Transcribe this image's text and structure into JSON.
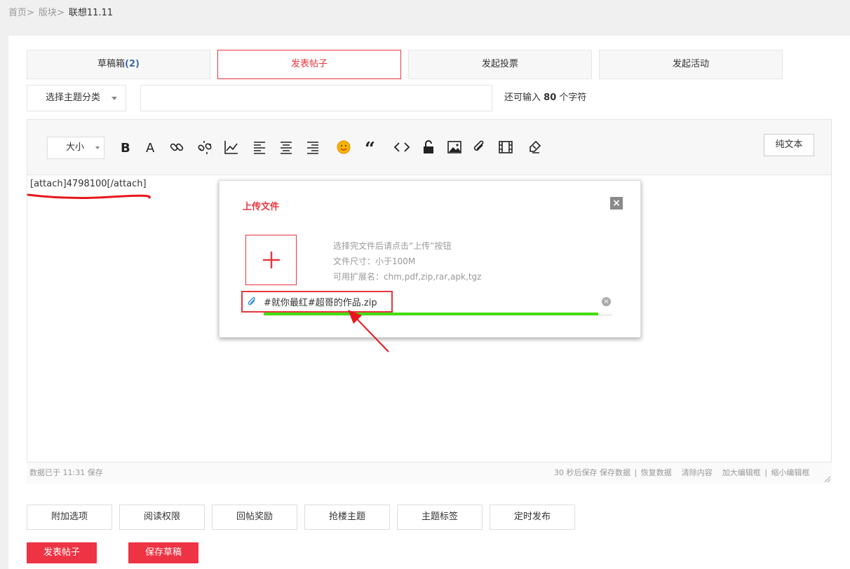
{
  "breadcrumb": {
    "home": "首页",
    "section": "版块",
    "current": "联想11.11",
    "separator": ">"
  },
  "tabs": [
    {
      "label": "草稿箱",
      "count": "(2)"
    },
    {
      "label": "发表帖子"
    },
    {
      "label": "发起投票"
    },
    {
      "label": "发起活动"
    }
  ],
  "category_select": {
    "label": "选择主题分类"
  },
  "title_input": {
    "value": "",
    "placeholder": ""
  },
  "char_remaining": {
    "prefix": "还可输入",
    "count": "80",
    "suffix": "个字符"
  },
  "toolbar": {
    "size_label": "大小",
    "icons": [
      "bold-icon",
      "font-color-icon",
      "link-icon",
      "unlink-icon",
      "chart-icon",
      "align-left-icon",
      "align-center-icon",
      "align-right-icon",
      "emoji-icon",
      "quote-icon",
      "code-icon",
      "lock-icon",
      "image-icon",
      "attachment-icon",
      "video-icon",
      "clear-format-icon"
    ],
    "plain_text_label": "纯文本"
  },
  "editor": {
    "content": "[attach]4798100[/attach]"
  },
  "status": {
    "saved": "数据已于 11:31 保存",
    "autosave": "30 秒后保存",
    "save_data": "保存数据",
    "restore": "恢复数据",
    "clear": "清除内容",
    "enlarge": "加大编辑框",
    "shrink": "缩小编辑框",
    "divider": "|"
  },
  "upload_dialog": {
    "title": "上传文件",
    "hint1": "选择完文件后请点击“上传”按钮",
    "hint2": "文件尺寸：小于100M",
    "hint3": "可用扩展名：chm,pdf,zip,rar,apk,tgz",
    "file_name": "#就你最红#超哥的作品.zip",
    "progress": 0.96
  },
  "bottom_buttons": [
    "附加选项",
    "阅读权限",
    "回帖奖励",
    "抢楼主题",
    "主题标签",
    "定时发布"
  ],
  "actions": {
    "publish": "发表帖子",
    "save_draft": "保存草稿"
  },
  "colors": {
    "accent": "#e8363d",
    "progress": "#44dd11",
    "link_blue": "#3c6ca6"
  }
}
